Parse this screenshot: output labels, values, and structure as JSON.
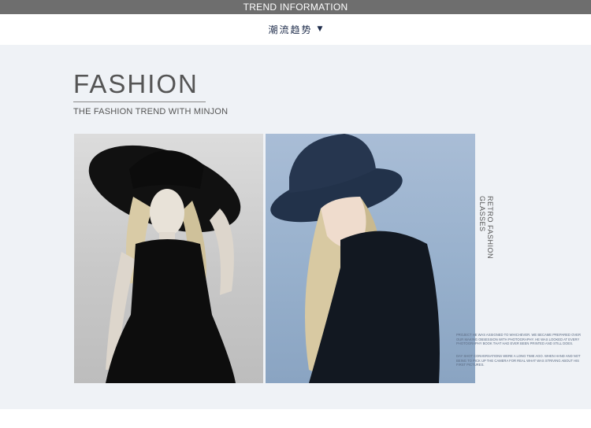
{
  "top_banner": {
    "title": "TREND INFORMATION"
  },
  "subnav": {
    "label": "潮流趋势",
    "arrow": "▼"
  },
  "section": {
    "heading": "FASHION",
    "tagline": "THE FASHION TREND WITH MINJON",
    "vertical_label": "RETRO FASHION GLASSES",
    "fine_print_1": "PROJECT HE WAS ASSIGNED TO WHICHEVER. WE BECAME PREPARED OVER OUR MAKING OBSESSION WITH PHOTOGRAPHY. HE WAS LOOKED AT EVERY PHOTOGRAPHY BOOK THAT HAD EVER BEEN PRINTED AND STILL DOES.",
    "fine_print_2": "DAY SHOT CONVERSATIONS WERE A LONG TIME AGO. WHEN HAND AND NOT BEING TO PICK UP THE CAMERA FOR REAL WHAT WAS STRIVING ABOUT HIS FIRST PICTURES."
  },
  "images": {
    "left": "black-and-white-woman-wide-brim-hat",
    "right": "woman-dark-fedora-blue-background"
  }
}
